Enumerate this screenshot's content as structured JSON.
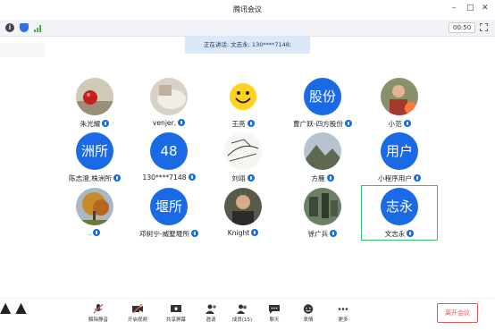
{
  "window": {
    "title": "腾讯会议",
    "controls": {
      "min": "–",
      "max": "□",
      "close": "✕"
    }
  },
  "statusbar": {
    "timer": "00:50",
    "info_glyph": "i"
  },
  "speaking": "正在讲话: 文志永; 130****7148;",
  "participants": [
    {
      "name": "朱光耀",
      "avatar_type": "photo",
      "avatar_desc": "red-fruit"
    },
    {
      "name": "venjer,",
      "avatar_type": "photo",
      "avatar_desc": "plate"
    },
    {
      "name": "王亮",
      "avatar_type": "photo",
      "avatar_desc": "smiley"
    },
    {
      "name": "曹广跃-四方股份",
      "avatar_type": "text",
      "avatar_text": "股份"
    },
    {
      "name": "小范",
      "avatar_type": "photo",
      "avatar_desc": "person"
    },
    {
      "name": "陈志澄,株洲所",
      "avatar_type": "text",
      "avatar_text": "洲所"
    },
    {
      "name": "130****7148",
      "avatar_type": "text",
      "avatar_text": "48"
    },
    {
      "name": "刘翊",
      "avatar_type": "photo",
      "avatar_desc": "sketch"
    },
    {
      "name": "方雁",
      "avatar_type": "photo",
      "avatar_desc": "mountain"
    },
    {
      "name": "小程序用户",
      "avatar_type": "text",
      "avatar_text": "用户"
    },
    {
      "name": ".",
      "avatar_type": "photo",
      "avatar_desc": "autumn-tree"
    },
    {
      "name": "邓树宁-威墅堰所",
      "avatar_type": "text",
      "avatar_text": "堰所"
    },
    {
      "name": "Knight",
      "avatar_type": "photo",
      "avatar_desc": "man"
    },
    {
      "name": "徐广兵",
      "avatar_type": "photo",
      "avatar_desc": "city"
    },
    {
      "name": "文志永",
      "avatar_type": "text",
      "avatar_text": "志永"
    }
  ],
  "toolbar": {
    "unmute": "解除静音",
    "video": "开启视频",
    "share": "共享屏幕",
    "invite": "邀请",
    "members": "成员(15)",
    "chat": "聊天",
    "emoji": "表情",
    "more": "更多",
    "leave": "离开会议"
  },
  "colors": {
    "accent": "#1a6ae6",
    "highlight": "#35c46e",
    "leave": "#e25656"
  }
}
